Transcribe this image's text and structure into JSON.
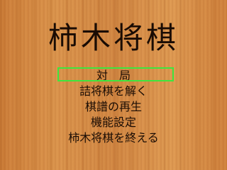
{
  "app": {
    "title": "柿木将棋"
  },
  "menu": {
    "selected_index": 0,
    "selection_color": "#3ee53e",
    "items": [
      {
        "label": "対　局"
      },
      {
        "label": "詰将棋を解く"
      },
      {
        "label": "棋譜の再生"
      },
      {
        "label": "機能設定"
      },
      {
        "label": "柿木将棋を終える"
      }
    ]
  }
}
